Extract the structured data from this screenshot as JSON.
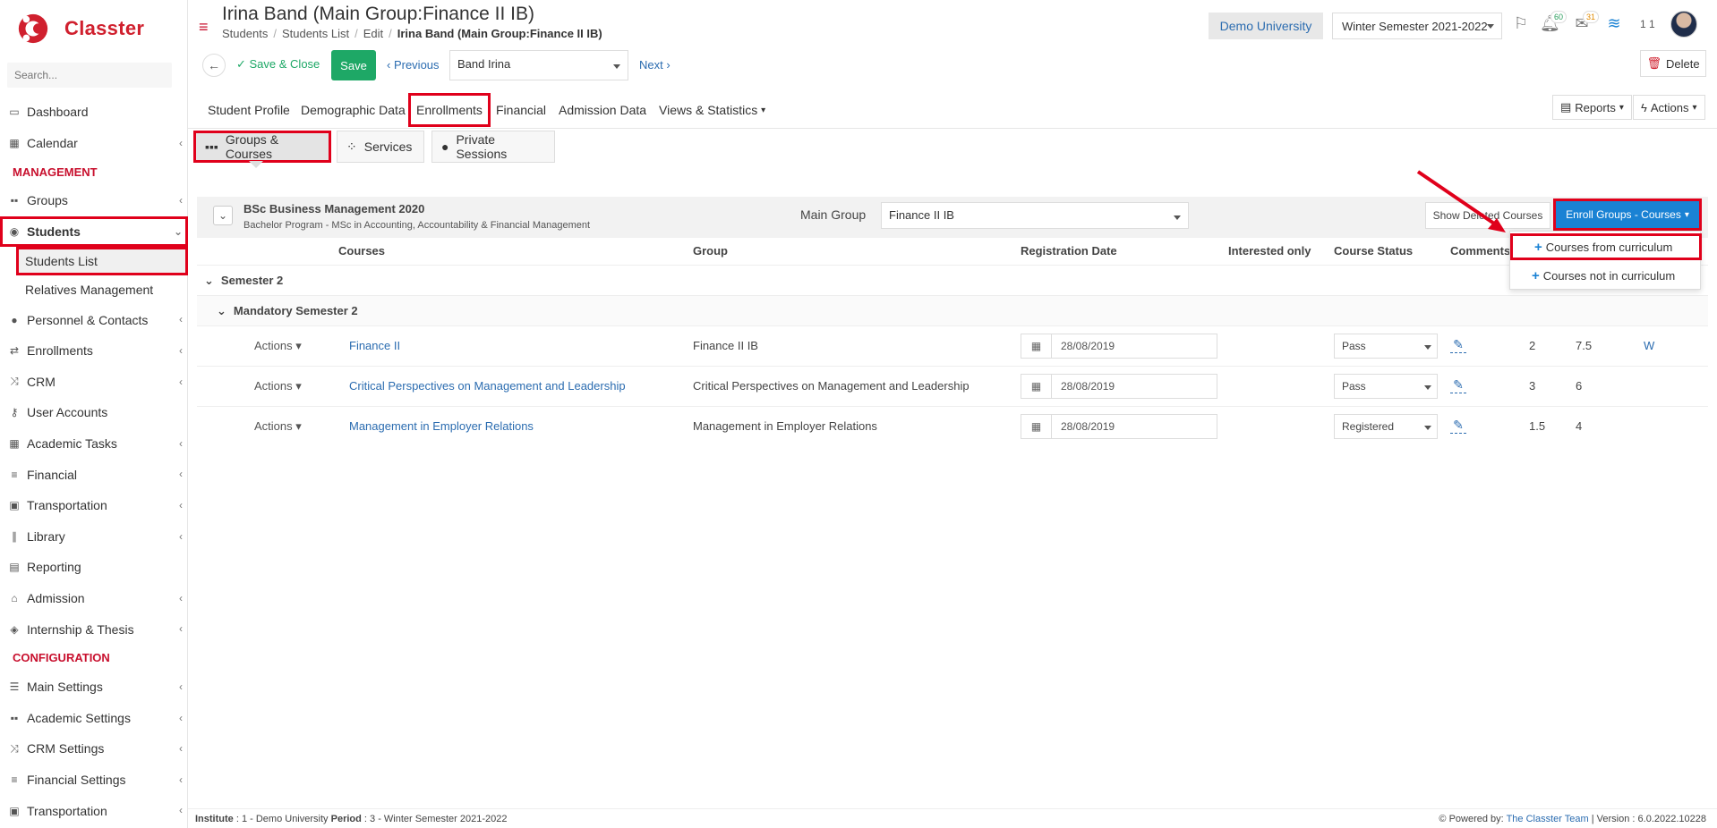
{
  "app": {
    "name": "Classter"
  },
  "sidebar": {
    "search_placeholder": "Search...",
    "items": [
      {
        "label": "Dashboard",
        "icon": "monitor-icon",
        "chevron": false
      },
      {
        "label": "Calendar",
        "icon": "calendar-icon",
        "chevron": true
      }
    ],
    "management_label": "MANAGEMENT",
    "management_items": [
      {
        "label": "Groups",
        "icon": "groups-icon",
        "chevron": true
      },
      {
        "label": "Students",
        "icon": "students-icon",
        "chevron": true,
        "expanded": true
      }
    ],
    "students_sub": [
      {
        "label": "Students List",
        "active": true
      },
      {
        "label": "Relatives Management",
        "active": false
      }
    ],
    "management_items2": [
      {
        "label": "Personnel & Contacts",
        "icon": "person-icon",
        "chevron": true
      },
      {
        "label": "Enrollments",
        "icon": "swap-icon",
        "chevron": true
      },
      {
        "label": "CRM",
        "icon": "shuffle-icon",
        "chevron": true
      },
      {
        "label": "User Accounts",
        "icon": "key-icon",
        "chevron": false
      },
      {
        "label": "Academic Tasks",
        "icon": "grid-icon",
        "chevron": true
      },
      {
        "label": "Financial",
        "icon": "coins-icon",
        "chevron": true
      },
      {
        "label": "Transportation",
        "icon": "bus-icon",
        "chevron": true
      },
      {
        "label": "Library",
        "icon": "books-icon",
        "chevron": true
      },
      {
        "label": "Reporting",
        "icon": "printer-icon",
        "chevron": false
      },
      {
        "label": "Admission",
        "icon": "bank-icon",
        "chevron": true
      },
      {
        "label": "Internship & Thesis",
        "icon": "box-icon",
        "chevron": true
      }
    ],
    "configuration_label": "CONFIGURATION",
    "configuration_items": [
      {
        "label": "Main Settings",
        "icon": "sliders-icon",
        "chevron": true
      },
      {
        "label": "Academic Settings",
        "icon": "groups-icon",
        "chevron": true
      },
      {
        "label": "CRM Settings",
        "icon": "shuffle-icon",
        "chevron": true
      },
      {
        "label": "Financial Settings",
        "icon": "coins-icon",
        "chevron": true
      },
      {
        "label": "Transportation",
        "icon": "bus-icon",
        "chevron": true
      }
    ]
  },
  "header": {
    "title": "Irina Band (Main Group:Finance II IB)",
    "breadcrumb": [
      "Students",
      "Students List",
      "Edit"
    ],
    "breadcrumb_current": "Irina Band (Main Group:Finance II IB)",
    "university": "Demo University",
    "semester": "Winter Semester 2021-2022",
    "notif_count": "60",
    "mail_count": "31",
    "user_num": "1 1"
  },
  "toolbar": {
    "save_close": "Save & Close",
    "save": "Save",
    "previous": "Previous",
    "student_value": "Band Irina",
    "next": "Next",
    "delete": "Delete"
  },
  "tabs": [
    "Student Profile",
    "Demographic Data",
    "Enrollments",
    "Financial",
    "Admission Data",
    "Views & Statistics"
  ],
  "reports": "Reports",
  "actions": "Actions",
  "subtabs": [
    "Groups & Courses",
    "Services",
    "Private Sessions"
  ],
  "program": {
    "title": "BSc Business Management 2020",
    "subtitle": "Bachelor Program - MSc in Accounting, Accountability & Financial Management",
    "main_group_label": "Main Group",
    "main_group_value": "Finance II IB",
    "show_deleted": "Show Deleted Courses",
    "enroll_btn": "Enroll Groups - Courses"
  },
  "enroll_menu": [
    "Courses from curriculum",
    "Courses not in curriculum"
  ],
  "table": {
    "headers": [
      "Courses",
      "Group",
      "Registration Date",
      "Interested only",
      "Course Status",
      "Comments"
    ],
    "semester": "Semester 2",
    "subgroup": "Mandatory Semester 2",
    "actions_label": "Actions",
    "rows": [
      {
        "course": "Finance II",
        "group": "Finance II IB",
        "date": "28/08/2019",
        "status": "Pass",
        "c1": "2",
        "c2": "7.5",
        "c3": "W"
      },
      {
        "course": "Critical Perspectives on Management and Leadership",
        "group": "Critical Perspectives on Management and Leadership",
        "date": "28/08/2019",
        "status": "Pass",
        "c1": "3",
        "c2": "6",
        "c3": ""
      },
      {
        "course": "Management in Employer Relations",
        "group": "Management in Employer Relations",
        "date": "28/08/2019",
        "status": "Registered",
        "c1": "1.5",
        "c2": "4",
        "c3": ""
      }
    ]
  },
  "footer": {
    "institute_label": "Institute",
    "institute_value": ": 1 - Demo University",
    "period_label": "Period",
    "period_value": ": 3 - Winter Semester 2021-2022",
    "powered": "Powered by:",
    "team": "The Classter Team",
    "version": "| Version : 6.0.2022.10228"
  }
}
